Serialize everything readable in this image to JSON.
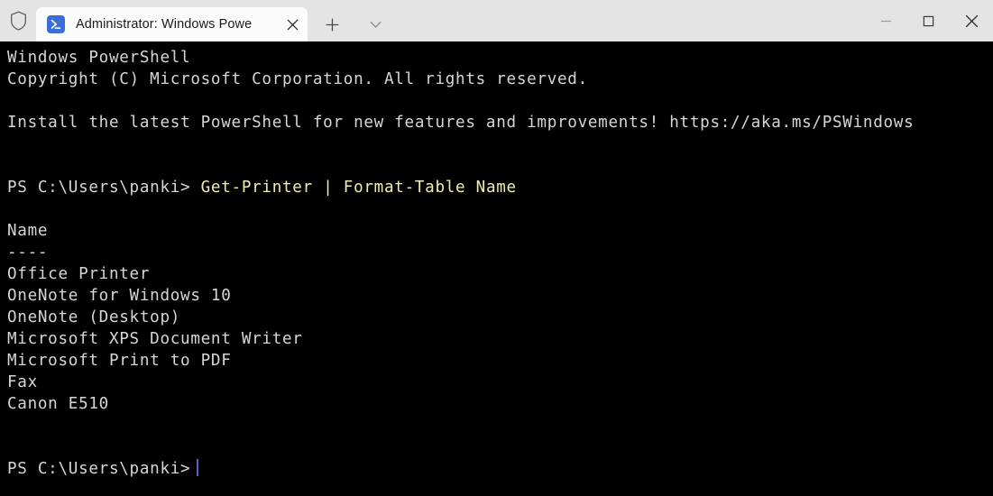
{
  "window": {
    "titlebar": {
      "shield_icon": "shield-icon",
      "tab": {
        "icon": "powershell-icon",
        "title": "Administrator: Windows Powe",
        "close_icon": "close-icon"
      },
      "new_tab_icon": "plus-icon",
      "dropdown_icon": "chevron-down-icon",
      "controls": {
        "minimize_icon": "minimize-icon",
        "maximize_icon": "maximize-icon",
        "close_icon": "close-icon"
      }
    },
    "colors": {
      "titlebar_bg": "#e4e4e4",
      "tab_bg": "#fbfbfb",
      "terminal_bg": "#000000",
      "terminal_fg": "#d6d6d6",
      "command_fg": "#efeeab",
      "cursor": "#5a5ad8",
      "powershell_icon_bg": "#3a6fd8"
    }
  },
  "terminal": {
    "lines": [
      {
        "text": "Windows PowerShell"
      },
      {
        "text": "Copyright (C) Microsoft Corporation. All rights reserved."
      },
      {
        "text": ""
      },
      {
        "text": "Install the latest PowerShell for new features and improvements! https://aka.ms/PSWindows"
      },
      {
        "text": ""
      },
      {
        "text": ""
      },
      {
        "text": "PS C:\\Users\\panki> ",
        "command": "Get-Printer | Format-Table Name"
      },
      {
        "text": ""
      },
      {
        "text": "Name"
      },
      {
        "text": "----"
      },
      {
        "text": "Office Printer"
      },
      {
        "text": "OneNote for Windows 10"
      },
      {
        "text": "OneNote (Desktop)"
      },
      {
        "text": "Microsoft XPS Document Writer"
      },
      {
        "text": "Microsoft Print to PDF"
      },
      {
        "text": "Fax"
      },
      {
        "text": "Canon E510"
      },
      {
        "text": ""
      },
      {
        "text": ""
      },
      {
        "text": "PS C:\\Users\\panki>",
        "cursor": true
      }
    ]
  }
}
